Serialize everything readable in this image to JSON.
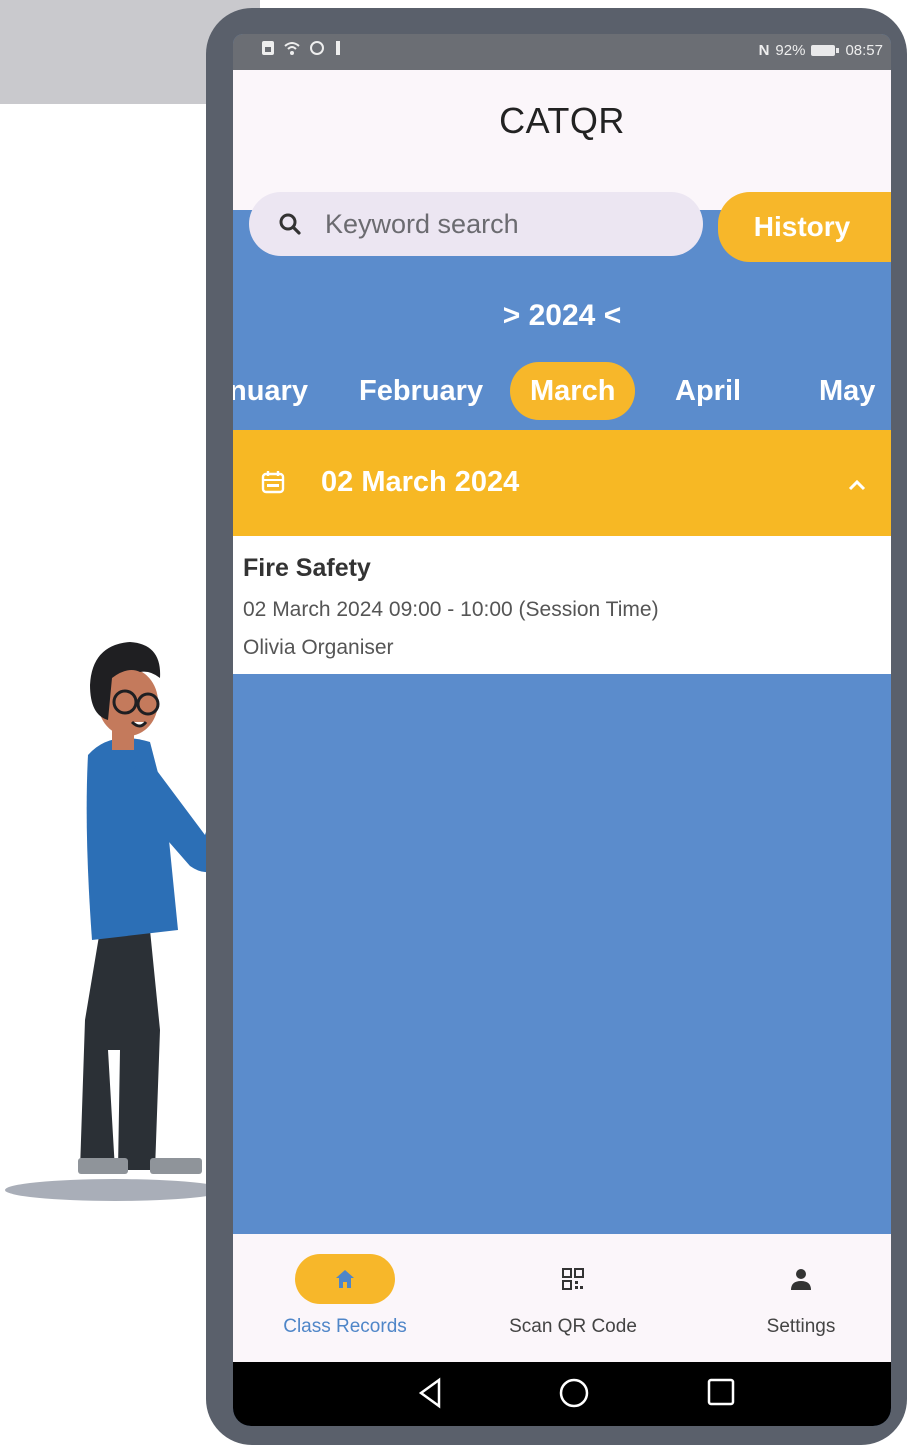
{
  "status_bar": {
    "left_icons": [
      "sim-icon",
      "wifi-icon",
      "data-saver-icon",
      "usb-icon"
    ],
    "nfc": "N",
    "battery": "92%",
    "time": "08:57"
  },
  "app": {
    "title": "CATQR"
  },
  "search": {
    "placeholder": "Keyword search"
  },
  "history_button": "History",
  "year_selector": "> 2024 <",
  "months": [
    "nuary",
    "February",
    "March",
    "April",
    "May"
  ],
  "selected_month": "March",
  "date_group": {
    "date": "02 March 2024",
    "icon": "calendar-icon",
    "collapse_icon": "chevron-up-icon"
  },
  "records": [
    {
      "title": "Fire Safety",
      "time": "02 March 2024 09:00 - 10:00 (Session Time)",
      "organiser": "Olivia Organiser"
    }
  ],
  "bottom_nav": [
    {
      "label": "Class Records",
      "icon": "home-icon",
      "active": true
    },
    {
      "label": "Scan QR Code",
      "icon": "qr-code-icon",
      "active": false
    },
    {
      "label": "Settings",
      "icon": "person-icon",
      "active": false
    }
  ],
  "colors": {
    "accent": "#f7b72a",
    "primary_blue": "#5b8ccc",
    "active_nav_label": "#4f86c8"
  }
}
